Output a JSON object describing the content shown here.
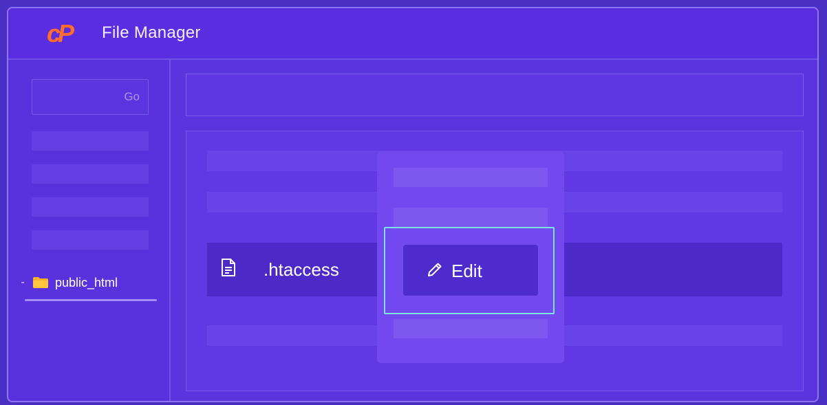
{
  "header": {
    "logo_text": "cP",
    "title": "File Manager"
  },
  "sidebar": {
    "go_label": "Go",
    "tree": {
      "expander": "-",
      "folder_label": "public_html"
    }
  },
  "file_list": {
    "selected_file": ".htaccess"
  },
  "context_menu": {
    "edit_label": "Edit"
  },
  "colors": {
    "brand_logo": "#ff6c2c",
    "accent_focus": "#7fe1e8",
    "background": "#5a34dc"
  },
  "icons": {
    "logo": "cpanel-logo",
    "folder": "folder-icon",
    "file": "file-text-icon",
    "edit": "pencil-icon"
  }
}
